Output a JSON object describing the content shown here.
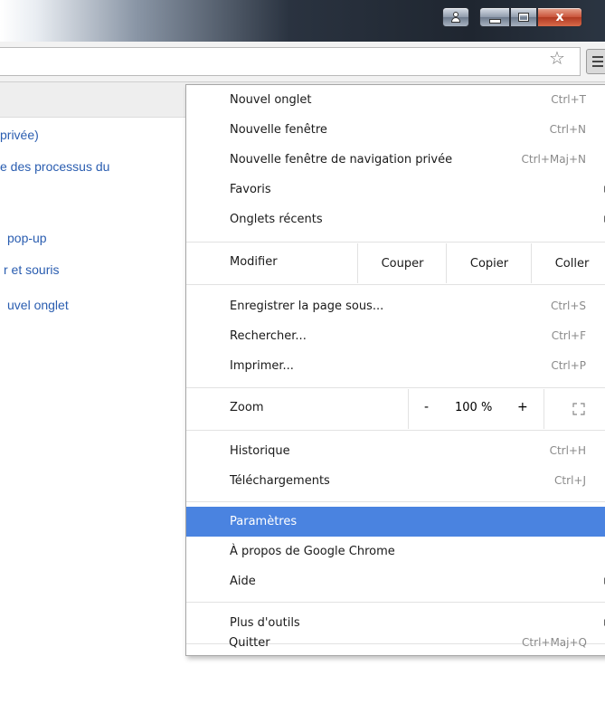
{
  "window": {
    "buttons": {
      "user_icon": "user-icon",
      "minimize_icon": "minimize-icon",
      "maximize_icon": "maximize-icon",
      "close_glyph": "x"
    }
  },
  "toolbar": {
    "bookmark_star": "☆"
  },
  "background": {
    "links": [
      "privée)",
      "e des processus du",
      "pop-up",
      "r et souris",
      "uvel onglet"
    ]
  },
  "menu": {
    "group1": [
      {
        "label": "Nouvel onglet",
        "shortcut": "Ctrl+T"
      },
      {
        "label": "Nouvelle fenêtre",
        "shortcut": "Ctrl+N"
      },
      {
        "label": "Nouvelle fenêtre de navigation privée",
        "shortcut": "Ctrl+Maj+N"
      },
      {
        "label": "Favoris",
        "shortcut": ""
      },
      {
        "label": "Onglets récents",
        "shortcut": ""
      }
    ],
    "edit": {
      "label": "Modifier",
      "cut": "Couper",
      "copy": "Copier",
      "paste": "Coller"
    },
    "group2": [
      {
        "label": "Enregistrer la page sous...",
        "shortcut": "Ctrl+S"
      },
      {
        "label": "Rechercher...",
        "shortcut": "Ctrl+F"
      },
      {
        "label": "Imprimer...",
        "shortcut": "Ctrl+P"
      }
    ],
    "zoom": {
      "label": "Zoom",
      "minus": "-",
      "value": "100 %",
      "plus": "+"
    },
    "group3": [
      {
        "label": "Historique",
        "shortcut": "Ctrl+H"
      },
      {
        "label": "Téléchargements",
        "shortcut": "Ctrl+J"
      }
    ],
    "group4": [
      {
        "label": "Paramètres",
        "highlighted": true
      },
      {
        "label": "À propos de Google Chrome"
      },
      {
        "label": "Aide"
      }
    ],
    "more_tools": "Plus d'outils",
    "quit": {
      "label": "Quitter",
      "shortcut": "Ctrl+Maj+Q"
    },
    "highlight_color": "#4a83e0"
  }
}
